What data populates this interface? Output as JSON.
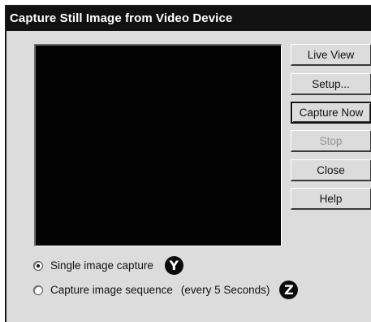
{
  "window": {
    "title": "Capture Still Image from Video Device"
  },
  "buttons": {
    "live_view": "Live View",
    "setup": "Setup...",
    "capture_now": "Capture Now",
    "stop": "Stop",
    "close": "Close",
    "help": "Help"
  },
  "options": {
    "single_label": "Single image capture",
    "single_selected": true,
    "sequence_label": "Capture image sequence",
    "sequence_interval": "(every 5 Seconds)",
    "sequence_selected": false
  },
  "badges": {
    "y": "Y",
    "z": "Z"
  },
  "colors": {
    "titlebar": "#111111",
    "dialog_bg": "#dcdcdc",
    "preview_bg": "#030303",
    "disabled_text": "#8f8f8f"
  }
}
